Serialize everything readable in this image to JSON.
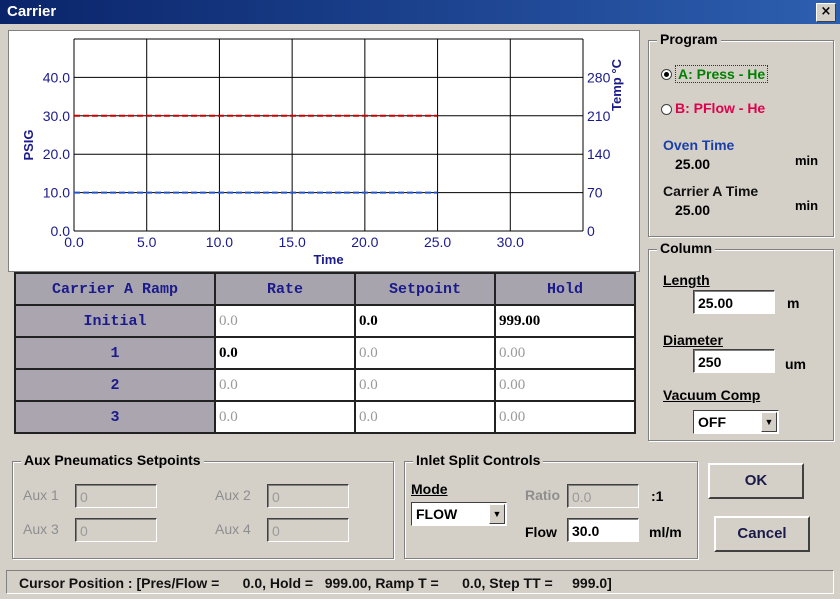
{
  "window": {
    "title": "Carrier",
    "close_glyph": "×"
  },
  "chart": {
    "left_axis_label": "PSIG",
    "right_axis_label": "Temp °C",
    "x_axis_label": "Time",
    "x_ticks": [
      "0.0",
      "5.0",
      "10.0",
      "15.0",
      "20.0",
      "25.0",
      "30.0"
    ],
    "left_ticks": [
      "0.0",
      "10.0",
      "20.0",
      "30.0",
      "40.0"
    ],
    "right_ticks": [
      "0",
      "70",
      "140",
      "210",
      "280"
    ],
    "colors": {
      "grid": "#000000",
      "pressure_line": "#cc0000",
      "oven_line": "#2255cc"
    }
  },
  "chart_data": {
    "type": "line",
    "xlabel": "Time",
    "ylabel": "PSIG",
    "y2label": "Temp °C",
    "xlim": [
      0,
      35
    ],
    "ylim": [
      0,
      50
    ],
    "y2lim": [
      0,
      350
    ],
    "series": [
      {
        "x": [
          0,
          25
        ],
        "values": [
          30,
          30
        ],
        "color": "#cc0000",
        "style": "dashed"
      },
      {
        "x": [
          0,
          25
        ],
        "values": [
          10,
          10
        ],
        "color": "#2255cc",
        "style": "dashed"
      }
    ],
    "grid": true
  },
  "ramp_table": {
    "headers": [
      "Carrier A Ramp",
      "Rate",
      "Setpoint",
      "Hold"
    ],
    "rows": [
      {
        "label": "Initial",
        "rate": "0.0",
        "setpoint": "0.0",
        "hold": "999.00"
      },
      {
        "label": "1",
        "rate": "0.0",
        "setpoint": "0.0",
        "hold": "0.00"
      },
      {
        "label": "2",
        "rate": "0.0",
        "setpoint": "0.0",
        "hold": "0.00"
      },
      {
        "label": "3",
        "rate": "0.0",
        "setpoint": "0.0",
        "hold": "0.00"
      }
    ]
  },
  "program": {
    "title": "Program",
    "option_a": "A: Press - He",
    "option_b": "B: PFlow - He",
    "oven_time_label": "Oven Time",
    "oven_time_value": "25.00",
    "oven_time_unit": "min",
    "carrier_time_label": "Carrier A Time",
    "carrier_time_value": "25.00",
    "carrier_time_unit": "min",
    "colors": {
      "a": "#008000",
      "b": "#e0004c",
      "label": "#1a3fa8"
    }
  },
  "column": {
    "title": "Column",
    "length_label": "Length",
    "length_value": "25.00",
    "length_unit": "m",
    "diameter_label": "Diameter",
    "diameter_value": "250",
    "diameter_unit": "um",
    "vacuum_label": "Vacuum Comp",
    "vacuum_value": "OFF"
  },
  "aux": {
    "title": "Aux Pneumatics Setpoints",
    "aux1_label": "Aux 1",
    "aux1_value": "0",
    "aux2_label": "Aux 2",
    "aux2_value": "0",
    "aux3_label": "Aux 3",
    "aux3_value": "0",
    "aux4_label": "Aux 4",
    "aux4_value": "0"
  },
  "inlet": {
    "title": "Inlet Split Controls",
    "mode_label": "Mode",
    "mode_value": "FLOW",
    "ratio_label": "Ratio",
    "ratio_value": "0.0",
    "ratio_unit": ":1",
    "flow_label": "Flow",
    "flow_value": "30.0",
    "flow_unit": "ml/m"
  },
  "buttons": {
    "ok": "OK",
    "cancel": "Cancel"
  },
  "status": "Cursor Position : [Pres/Flow =      0.0, Hold =   999.00, Ramp T =      0.0, Step TT =     999.0]"
}
